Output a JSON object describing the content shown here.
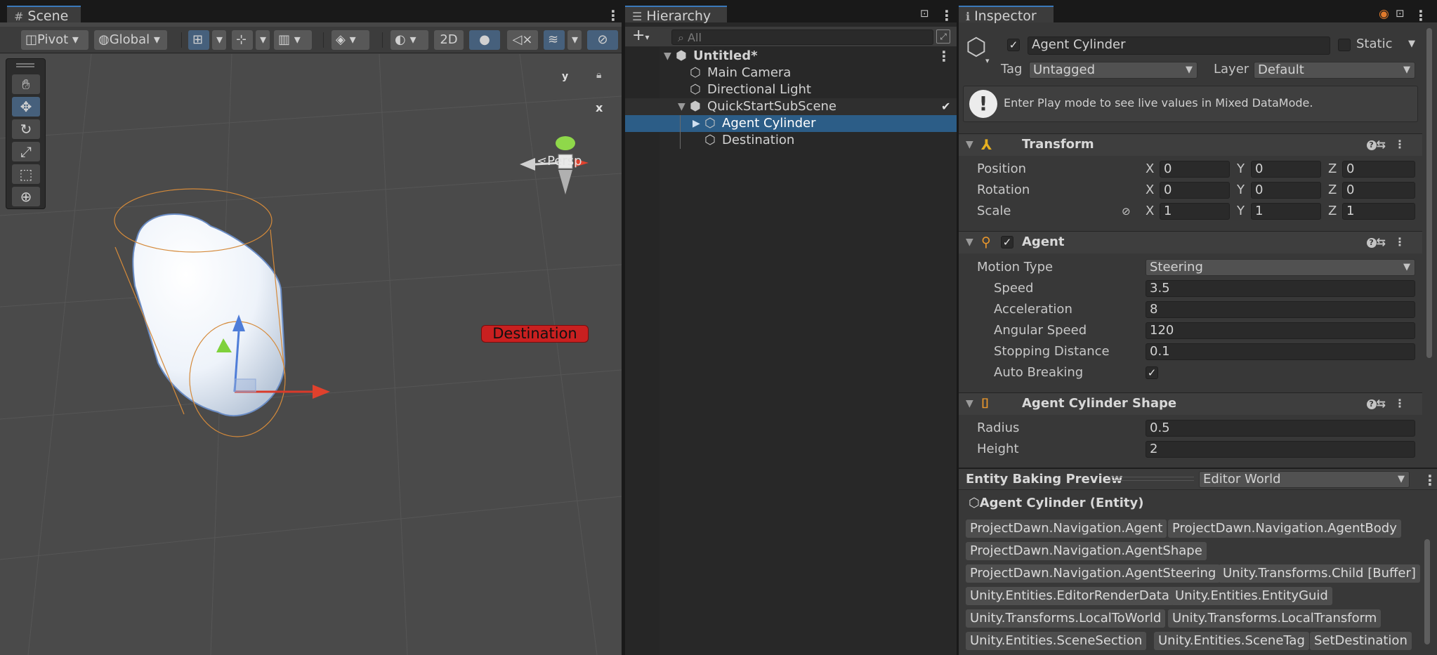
{
  "scene": {
    "tab_label": "Scene",
    "pivot_label": "Pivot",
    "global_label": "Global",
    "mode_2d_label": "2D",
    "persp_label": "Persp",
    "destination_label": "Destination",
    "gizmo_y": "y",
    "gizmo_x": "x"
  },
  "hierarchy": {
    "tab_label": "Hierarchy",
    "search_placeholder": "All",
    "items": [
      {
        "label": "Untitled*"
      },
      {
        "label": "Main Camera"
      },
      {
        "label": "Directional Light"
      },
      {
        "label": "QuickStartSubScene"
      },
      {
        "label": "Agent Cylinder"
      },
      {
        "label": "Destination"
      }
    ]
  },
  "inspector": {
    "tab_label": "Inspector",
    "object_name": "Agent Cylinder",
    "static_label": "Static",
    "tag_label": "Tag",
    "tag_value": "Untagged",
    "layer_label": "Layer",
    "layer_value": "Default",
    "info_message": "Enter Play mode to see live values in Mixed DataMode.",
    "transform": {
      "title": "Transform",
      "rows": [
        {
          "label": "Position",
          "x": "0",
          "y": "0",
          "z": "0"
        },
        {
          "label": "Rotation",
          "x": "0",
          "y": "0",
          "z": "0"
        },
        {
          "label": "Scale",
          "x": "1",
          "y": "1",
          "z": "1"
        }
      ],
      "axis_x": "X",
      "axis_y": "Y",
      "axis_z": "Z"
    },
    "agent": {
      "title": "Agent",
      "motion_type_label": "Motion Type",
      "motion_type_value": "Steering",
      "fields": [
        {
          "label": "Speed",
          "value": "3.5"
        },
        {
          "label": "Acceleration",
          "value": "8"
        },
        {
          "label": "Angular Speed",
          "value": "120"
        },
        {
          "label": "Stopping Distance",
          "value": "0.1"
        }
      ],
      "auto_breaking_label": "Auto Breaking"
    },
    "shape": {
      "title": "Agent Cylinder Shape",
      "radius_label": "Radius",
      "radius_value": "0.5",
      "height_label": "Height",
      "height_value": "2"
    },
    "baking": {
      "title": "Entity Baking Preview",
      "world_value": "Editor World",
      "entity_label": "Agent Cylinder (Entity)",
      "components": [
        [
          "ProjectDawn.Navigation.Agent",
          "ProjectDawn.Navigation.AgentBody"
        ],
        [
          "ProjectDawn.Navigation.AgentShape"
        ],
        [
          "ProjectDawn.Navigation.AgentSteering",
          "Unity.Transforms.Child [Buffer]"
        ],
        [
          "Unity.Entities.EditorRenderData",
          "Unity.Entities.EntityGuid"
        ],
        [
          "Unity.Transforms.LocalToWorld",
          "Unity.Transforms.LocalTransform"
        ],
        [
          "Unity.Entities.SceneSection",
          "Unity.Entities.SceneTag",
          "SetDestination"
        ]
      ]
    }
  }
}
